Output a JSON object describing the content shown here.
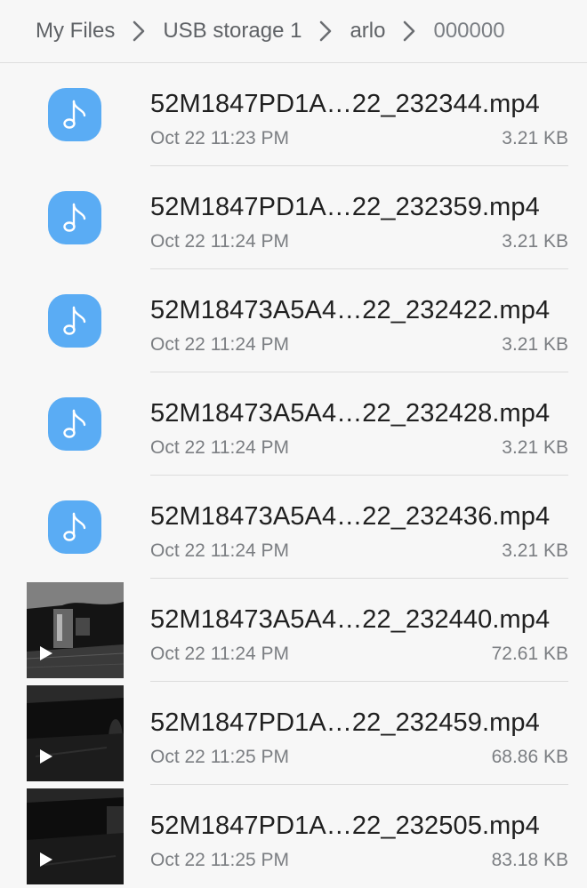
{
  "breadcrumb": {
    "items": [
      "My Files",
      "USB storage 1",
      "arlo",
      "000000"
    ]
  },
  "colors": {
    "audio_icon_bg": "#5aacf4",
    "background": "#f7f7f7"
  },
  "files": [
    {
      "name": "52M1847PD1A…22_232344.mp4",
      "date": "Oct 22 11:23 PM",
      "size": "3.21 KB",
      "icon": "music-note-icon"
    },
    {
      "name": "52M1847PD1A…22_232359.mp4",
      "date": "Oct 22 11:24 PM",
      "size": "3.21 KB",
      "icon": "music-note-icon"
    },
    {
      "name": "52M18473A5A4…22_232422.mp4",
      "date": "Oct 22 11:24 PM",
      "size": "3.21 KB",
      "icon": "music-note-icon"
    },
    {
      "name": "52M18473A5A4…22_232428.mp4",
      "date": "Oct 22 11:24 PM",
      "size": "3.21 KB",
      "icon": "music-note-icon"
    },
    {
      "name": "52M18473A5A4…22_232436.mp4",
      "date": "Oct 22 11:24 PM",
      "size": "3.21 KB",
      "icon": "music-note-icon"
    },
    {
      "name": "52M18473A5A4…22_232440.mp4",
      "date": "Oct 22 11:24 PM",
      "size": "72.61 KB",
      "icon": "video-thumbnail"
    },
    {
      "name": "52M1847PD1A…22_232459.mp4",
      "date": "Oct 22 11:25 PM",
      "size": "68.86 KB",
      "icon": "video-thumbnail"
    },
    {
      "name": "52M1847PD1A…22_232505.mp4",
      "date": "Oct 22 11:25 PM",
      "size": "83.18 KB",
      "icon": "video-thumbnail"
    }
  ]
}
